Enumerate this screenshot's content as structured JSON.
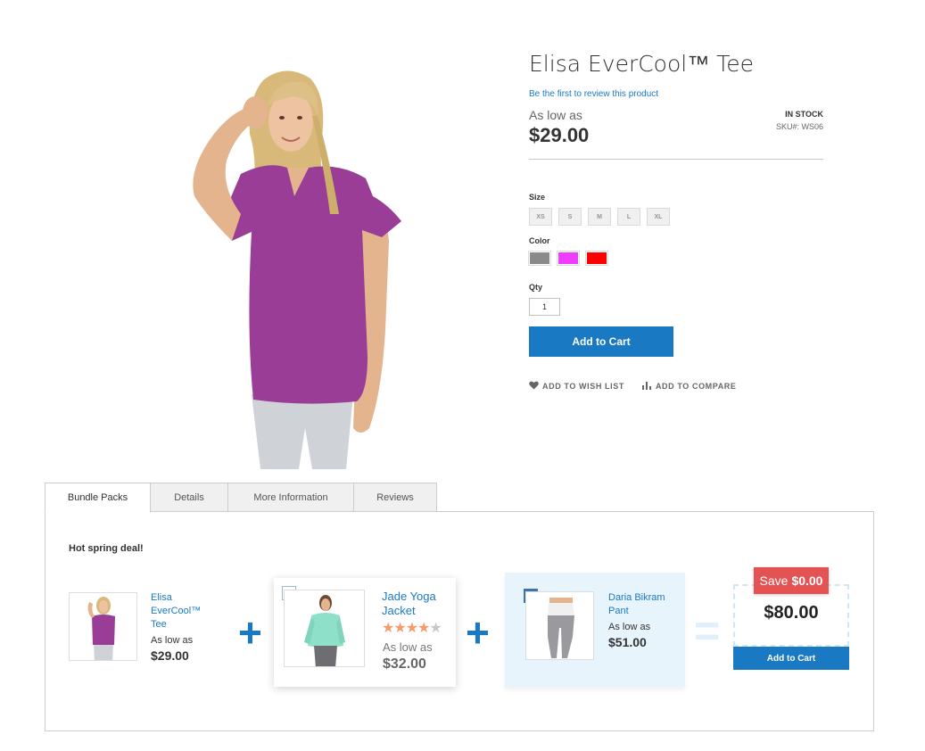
{
  "product": {
    "title": "Elisa EverCool™ Tee",
    "review_link": "Be the first to review this product",
    "as_low_as": "As low as",
    "price": "$29.00",
    "stock": "IN STOCK",
    "sku": "SKU#:  WS06",
    "size_label": "Size",
    "sizes": [
      "XS",
      "S",
      "M",
      "L",
      "XL"
    ],
    "color_label": "Color",
    "colors": [
      "#8a8a8a",
      "#ef3dff",
      "#ff0000"
    ],
    "qty_label": "Qty",
    "qty_value": "1",
    "add_to_cart": "Add to Cart",
    "wishlist": "ADD TO WISH LIST",
    "compare": "ADD TO COMPARE"
  },
  "tabs": [
    "Bundle Packs",
    "Details",
    "More Information",
    "Reviews"
  ],
  "bundle": {
    "deal_title": "Hot spring deal!",
    "items": [
      {
        "name_line1": "Elisa",
        "name_line2": "EverCool™",
        "name_line3": "Tee",
        "as_low_as": "As low as",
        "price": "$29.00"
      },
      {
        "name_line1": "Jade Yoga",
        "name_line2": "Jacket",
        "as_low_as": "As low as",
        "price": "$32.00",
        "rating": 4
      },
      {
        "name_line1": "Daria Bikram",
        "name_line2": "Pant",
        "as_low_as": "As low as",
        "price": "$51.00"
      }
    ],
    "save_prefix": "Save",
    "save_amount": "$0.00",
    "total": "$80.00",
    "add_to_cart": "Add to Cart",
    "accent": "#1979c3"
  }
}
